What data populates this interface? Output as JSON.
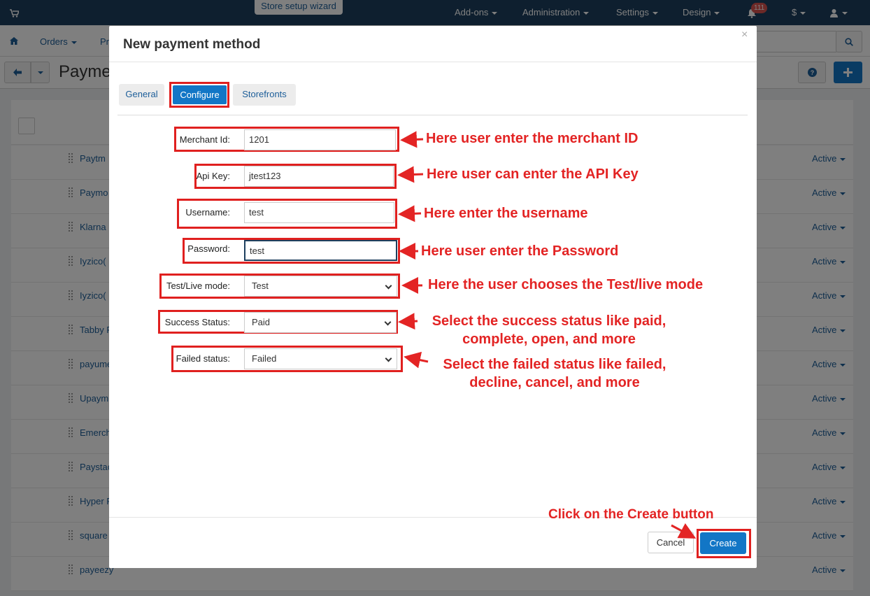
{
  "topbar": {
    "wizard": "Store setup wizard",
    "addons": "Add-ons",
    "administration": "Administration",
    "settings": "Settings",
    "design": "Design",
    "notif_count": "111",
    "currency": "$"
  },
  "nav": {
    "orders": "Orders",
    "products_partial": "Pr",
    "page_title_partial": "Payme"
  },
  "list": {
    "rows": [
      {
        "name": "Paytm",
        "status": "Active"
      },
      {
        "name": "Paymo",
        "status": "Active"
      },
      {
        "name": "Klarna",
        "status": "Active"
      },
      {
        "name": "Iyzico(",
        "status": "Active"
      },
      {
        "name": "Iyzico(",
        "status": "Active"
      },
      {
        "name": "Tabby P",
        "status": "Active"
      },
      {
        "name": "payume",
        "status": "Active"
      },
      {
        "name": "Upaym",
        "status": "Active"
      },
      {
        "name": "Emerch",
        "status": "Active"
      },
      {
        "name": "Paystac",
        "status": "Active"
      },
      {
        "name": "Hyper P",
        "status": "Active"
      },
      {
        "name": "square",
        "status": "Active"
      },
      {
        "name": "payeezy",
        "status": "Active"
      }
    ]
  },
  "modal": {
    "title": "New payment method",
    "close": "×",
    "tabs": {
      "general": "General",
      "configure": "Configure",
      "storefronts": "Storefronts"
    },
    "fields": {
      "merchant_id": {
        "label": "Merchant Id:",
        "value": "1201"
      },
      "api_key": {
        "label": "Api Key:",
        "value": "jtest123"
      },
      "username": {
        "label": "Username:",
        "value": "test"
      },
      "password": {
        "label": "Password:",
        "value": "test"
      },
      "test_live": {
        "label": "Test/Live mode:",
        "value": "Test"
      },
      "success_status": {
        "label": "Success Status:",
        "value": "Paid"
      },
      "failed_status": {
        "label": "Failed status:",
        "value": "Failed"
      }
    },
    "buttons": {
      "cancel": "Cancel",
      "create": "Create"
    }
  },
  "annotations": {
    "merchant": "Here user enter the merchant ID",
    "api": "Here user can enter the API Key",
    "username": "Here enter the username",
    "password": "Here user enter the Password",
    "mode": "Here the user chooses the Test/live mode",
    "success_l1": "Select the success status like paid,",
    "success_l2": "complete, open, and more",
    "failed_l1": "Select the failed status like failed,",
    "failed_l2": "decline, cancel, and more",
    "create": "Click on the Create button"
  },
  "colors": {
    "annotation": "#e32424",
    "primary": "#1276c6",
    "topbar": "#1d3f5e"
  },
  "icons": [
    "cart-icon",
    "home-icon",
    "back-arrow-icon",
    "help-icon",
    "plus-icon",
    "search-icon",
    "bell-icon",
    "user-icon",
    "close-icon",
    "chevron-down-icon"
  ]
}
